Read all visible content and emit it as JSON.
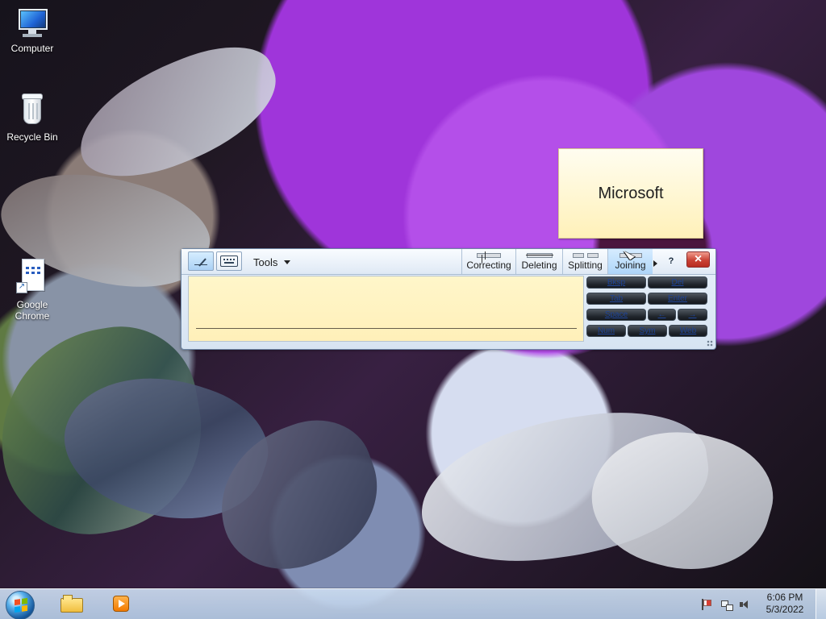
{
  "desktop": {
    "icons": [
      {
        "label": "Computer",
        "icon": "computer-icon"
      },
      {
        "label": "Recycle Bin",
        "icon": "recycle-bin-icon"
      },
      {
        "label": "Google Chrome",
        "icon": "chrome-shortcut-icon"
      }
    ]
  },
  "tooltip": {
    "text": "Microsoft"
  },
  "input_panel": {
    "tools_label": "Tools",
    "tabs": [
      {
        "label": "Correcting",
        "icon": "correcting-icon"
      },
      {
        "label": "Deleting",
        "icon": "deleting-icon"
      },
      {
        "label": "Splitting",
        "icon": "splitting-icon"
      },
      {
        "label": "Joining",
        "icon": "joining-icon"
      }
    ],
    "help_label": "?",
    "keys": [
      {
        "label": "Bksp"
      },
      {
        "label": "Del"
      },
      {
        "label": "Tab"
      },
      {
        "label": "Enter"
      },
      {
        "label": "Space"
      },
      {
        "label": "←"
      },
      {
        "label": "→"
      },
      {
        "label": "Num"
      },
      {
        "label": "Sym"
      },
      {
        "label": "Web"
      }
    ],
    "close_label": "×"
  },
  "taskbar": {
    "time": "6:06 PM",
    "date": "5/3/2022"
  },
  "colors": {
    "tooltip_bg": "#fff7cb",
    "panel_bg": "#dfe9f5",
    "writing_area_bg": "#fff3c1",
    "key_text": "#1f4599",
    "close_button": "#c94235",
    "taskbar_bg": "#c6d8ef"
  }
}
